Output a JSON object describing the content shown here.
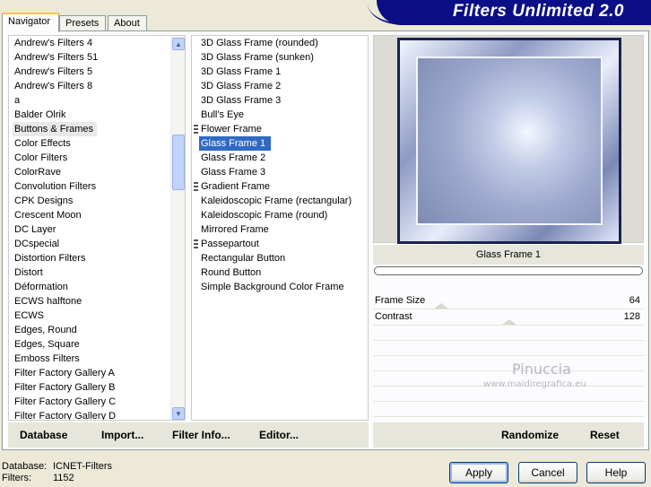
{
  "title": "Filters Unlimited 2.0",
  "tabs": [
    "Navigator",
    "Presets",
    "About"
  ],
  "categories": [
    "Andrew's Filters 4",
    "Andrew's Filters 51",
    "Andrew's Filters 5",
    "Andrew's Filters 8",
    "a",
    "Balder Olrik",
    "Buttons & Frames",
    "Color Effects",
    "Color Filters",
    "ColorRave",
    "Convolution Filters",
    "CPK Designs",
    "Crescent Moon",
    "DC Layer",
    "DCspecial",
    "Distortion Filters",
    "Distort",
    "Déformation",
    "ECWS halftone",
    "ECWS",
    "Edges, Round",
    "Edges, Square",
    "Emboss Filters",
    "Filter Factory Gallery A",
    "Filter Factory Gallery B",
    "Filter Factory Gallery C",
    "Filter Factory Gallery D"
  ],
  "filters": [
    "3D Glass Frame (rounded)",
    "3D Glass Frame (sunken)",
    "3D Glass Frame 1",
    "3D Glass Frame 2",
    "3D Glass Frame 3",
    "Bull's Eye",
    "Flower Frame",
    "Glass Frame 1",
    "Glass Frame 2",
    "Glass Frame 3",
    "Gradient Frame",
    "Kaleidoscopic Frame (rectangular)",
    "Kaleidoscopic Frame (round)",
    "Mirrored Frame",
    "Passepartout",
    "Rectangular Button",
    "Round Button",
    "Simple Background Color Frame"
  ],
  "selected_category": "Buttons & Frames",
  "selected_filter": "Glass Frame 1",
  "preview_caption": "Glass Frame 1",
  "params": [
    {
      "label": "Frame Size",
      "value": "64"
    },
    {
      "label": "Contrast",
      "value": "128"
    }
  ],
  "watermark": {
    "line1": "Pinuccia",
    "line2": "www.maidiregrafica.eu"
  },
  "toolbar_left": [
    "Database",
    "Import...",
    "Filter Info...",
    "Editor..."
  ],
  "toolbar_right": [
    "Randomize",
    "Reset"
  ],
  "status": {
    "database_label": "Database:",
    "database_value": "ICNET-Filters",
    "filters_label": "Filters:",
    "filters_value": "1152"
  },
  "buttons": {
    "apply": "Apply",
    "cancel": "Cancel",
    "help": "Help"
  }
}
